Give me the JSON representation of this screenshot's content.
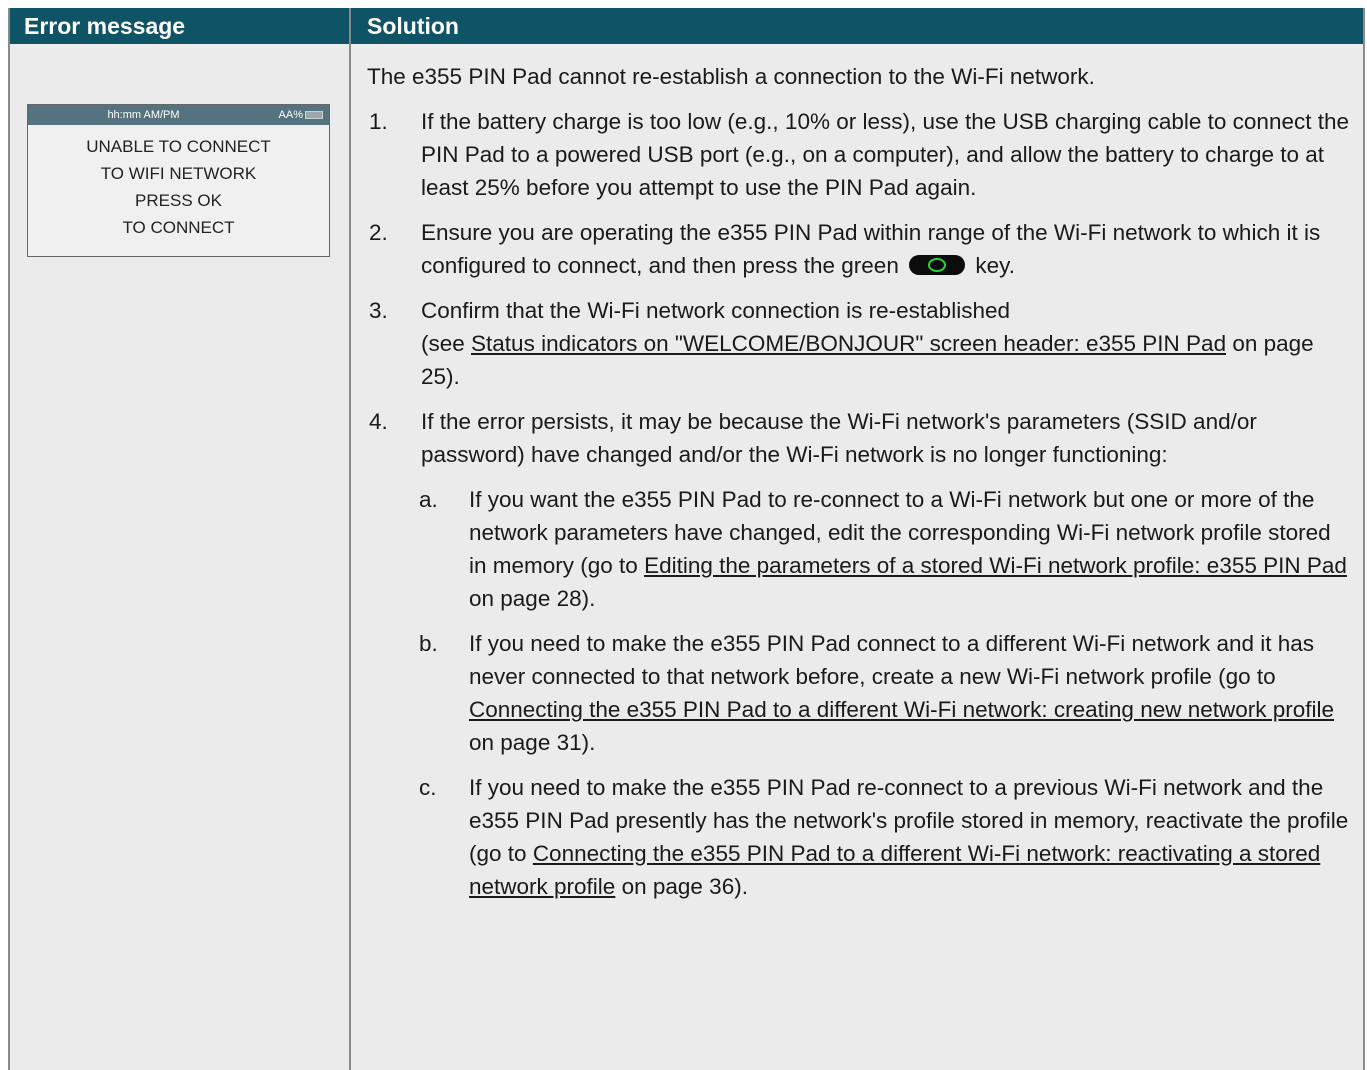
{
  "header": {
    "col1": "Error message",
    "col2": "Solution"
  },
  "screen": {
    "time": "hh:mm AM/PM",
    "battery": "AA%",
    "lines": [
      "UNABLE TO CONNECT",
      "TO WIFI NETWORK",
      "PRESS OK",
      "TO CONNECT"
    ]
  },
  "solution": {
    "intro": "The e355 PIN Pad cannot re-establish a connection to the Wi-Fi network.",
    "step1": {
      "num": "1.",
      "text": "If the battery charge is too low (e.g., 10% or less), use the USB charging cable to connect the PIN Pad to a powered USB port (e.g., on a computer), and allow the battery to charge to at least 25% before you attempt to use the PIN Pad again."
    },
    "step2": {
      "num": "2.",
      "text_a": "Ensure you are operating the e355 PIN Pad within range of the Wi-Fi network to which it is configured to connect, and then press the green",
      "text_b": "key."
    },
    "step3": {
      "num": "3.",
      "text_a": "Confirm that the Wi-Fi network connection is re-established (see",
      "link": "Status indicators on \"WELCOME/BONJOUR\" screen header: e355 PIN Pad",
      "text_b": "on page 25)."
    },
    "step4": {
      "num": "4.",
      "text": "If the error persists, it may be because the Wi-Fi network's parameters (SSID and/or password) have changed and/or the Wi-Fi network is no longer functioning:",
      "a": {
        "num": "a.",
        "text_a": "If you want the e355 PIN Pad to re-connect to a Wi-Fi network but one or more of the network parameters have changed, edit the corresponding Wi-Fi network profile stored in memory (go to",
        "link": "Editing the parameters of a stored Wi-Fi network profile: e355 PIN Pad",
        "text_b": "on page 28)."
      },
      "b": {
        "num": "b.",
        "text_a": "If you need to make the e355 PIN Pad connect to a different Wi-Fi network and it has never connected to that network before, create a new Wi-Fi network profile (go to",
        "link": "Connecting the e355 PIN Pad to a different Wi-Fi network: creating new network profile",
        "text_b": "on page 31)."
      },
      "c": {
        "num": "c.",
        "text_a": "If you need to make the e355 PIN Pad re-connect to a previous Wi-Fi network and the e355 PIN Pad presently has the network's profile stored in memory, reactivate the profile (go to",
        "link": "Connecting the e355 PIN Pad to a different Wi-Fi network: reactivating a stored network profile",
        "text_b": "on page 36)."
      }
    }
  },
  "colors": {
    "header_bg": "#0f5466",
    "cell_bg": "#ebebeb",
    "screen_bar": "#55727f",
    "key_ring": "#2ecf3c"
  }
}
